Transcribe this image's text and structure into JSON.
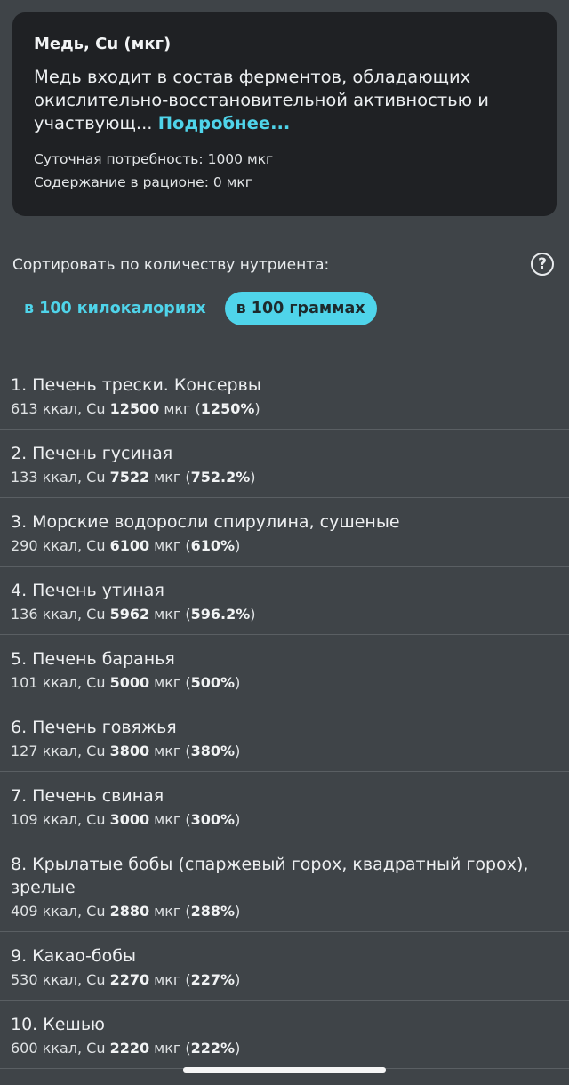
{
  "card": {
    "title": "Медь, Cu (мкг)",
    "description": "Медь входит в состав ферментов, обладающих окислительно-восстановительной активностью и участвующ...",
    "more_link": "Подробнее...",
    "daily_need": "Суточная потребность: 1000 мкг",
    "diet_content": "Содержание в рационе: 0 мкг"
  },
  "sort": {
    "label": "Сортировать по количеству нутриента:",
    "help_icon": "?",
    "tabs": [
      {
        "label": "в 100 килокалориях",
        "active": false
      },
      {
        "label": "в 100 граммах",
        "active": true
      }
    ]
  },
  "colors": {
    "accent": "#4fd4ea",
    "background": "#3f4448",
    "card": "#1f2124"
  },
  "list": [
    {
      "name": "1. Печень трески. Консервы",
      "kcal": "613 ккал, Cu ",
      "amount": "12500",
      "unit": " мкг (",
      "pct": "1250%",
      "close": ")"
    },
    {
      "name": "2. Печень гусиная",
      "kcal": "133 ккал, Cu ",
      "amount": "7522",
      "unit": " мкг (",
      "pct": "752.2%",
      "close": ")"
    },
    {
      "name": "3. Морские водоросли спирулина, сушеные",
      "kcal": "290 ккал, Cu ",
      "amount": "6100",
      "unit": " мкг (",
      "pct": "610%",
      "close": ")"
    },
    {
      "name": "4. Печень утиная",
      "kcal": "136 ккал, Cu ",
      "amount": "5962",
      "unit": " мкг (",
      "pct": "596.2%",
      "close": ")"
    },
    {
      "name": "5. Печень баранья",
      "kcal": "101 ккал, Cu ",
      "amount": "5000",
      "unit": " мкг (",
      "pct": "500%",
      "close": ")"
    },
    {
      "name": "6. Печень говяжья",
      "kcal": "127 ккал, Cu ",
      "amount": "3800",
      "unit": " мкг (",
      "pct": "380%",
      "close": ")"
    },
    {
      "name": "7. Печень свиная",
      "kcal": "109 ккал, Cu ",
      "amount": "3000",
      "unit": " мкг (",
      "pct": "300%",
      "close": ")"
    },
    {
      "name": "8. Крылатые бобы (спаржевый горох, квадратный горох), зрелые",
      "kcal": "409 ккал, Cu ",
      "amount": "2880",
      "unit": " мкг (",
      "pct": "288%",
      "close": ")"
    },
    {
      "name": "9. Какао-бобы",
      "kcal": "530 ккал, Cu ",
      "amount": "2270",
      "unit": " мкг (",
      "pct": "227%",
      "close": ")"
    },
    {
      "name": "10. Кешью",
      "kcal": "600 ккал, Cu ",
      "amount": "2220",
      "unit": " мкг (",
      "pct": "222%",
      "close": ")"
    }
  ]
}
